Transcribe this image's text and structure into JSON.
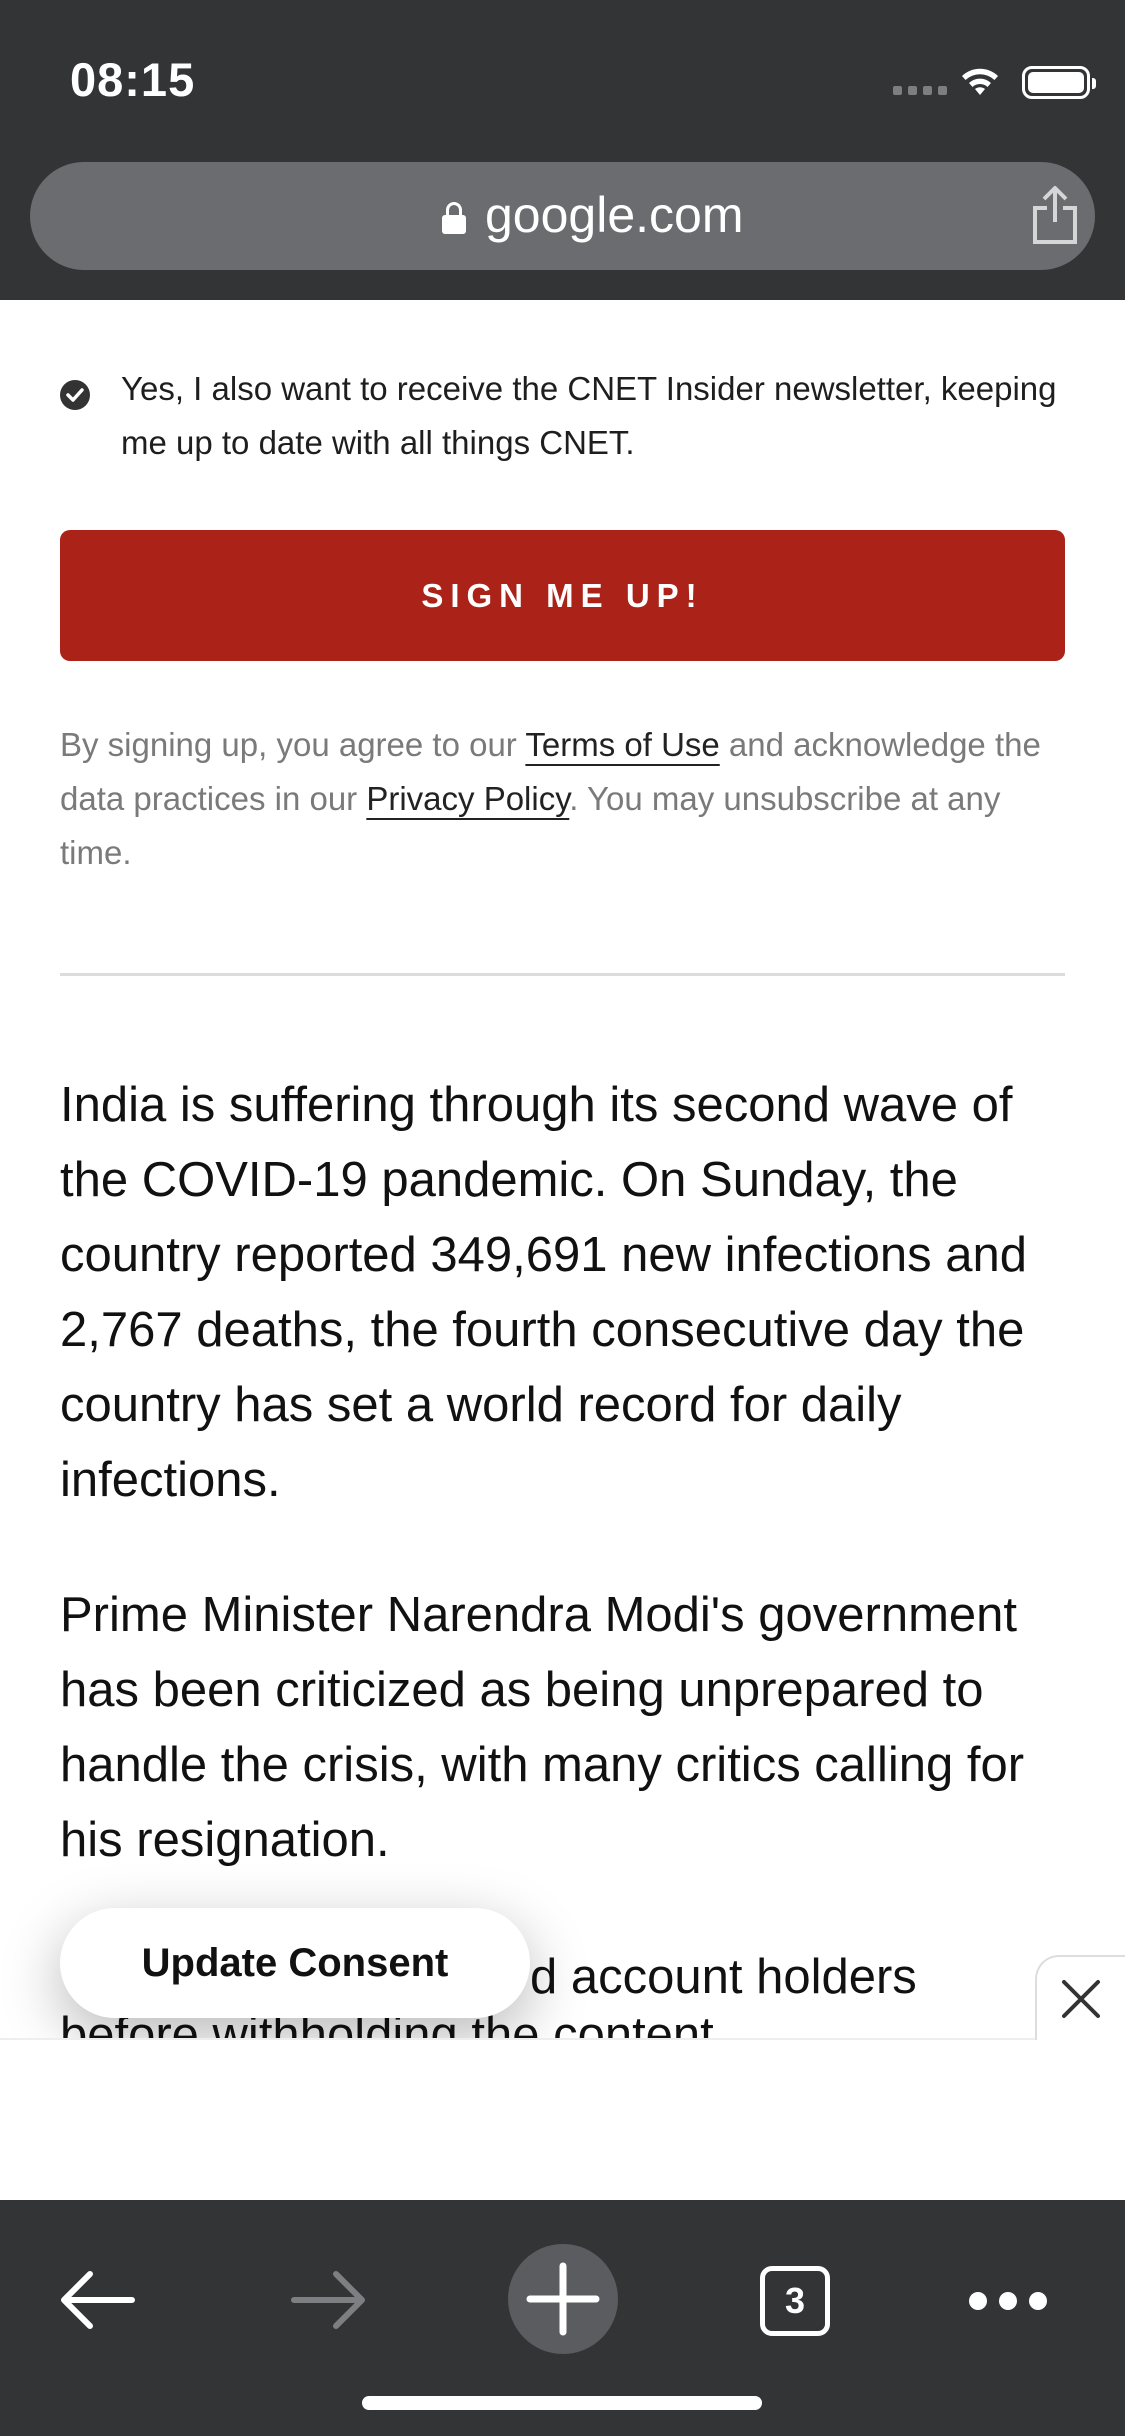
{
  "status_bar": {
    "time": "08:15"
  },
  "address_bar": {
    "domain": "google.com"
  },
  "newsletter": {
    "checkbox_label": "Yes, I also want to receive the CNET Insider newsletter, keeping me up to date with all things CNET.",
    "signup_button": "SIGN ME UP!",
    "legal_prefix": "By signing up, you agree to our ",
    "terms_link": "Terms of Use",
    "legal_middle": " and acknowledge the data practices in our ",
    "privacy_link": "Privacy Policy",
    "legal_suffix": ". You may unsubscribe at any time."
  },
  "article": {
    "paragraphs": [
      "India is suffering through its second wave of the COVID-19 pandemic. On Sunday, the country reported 349,691 new infections and 2,767 deaths, the fourth consecutive day the country has set a world record for daily infections.",
      "Prime Minister Narendra Modi's government has been criticized as being unprepared to handle the crisis, with many critics calling for his resignation."
    ],
    "partial_line": "d account holders",
    "partial_line_2": "before withholding the content"
  },
  "consent": {
    "button_label": "Update Consent"
  },
  "toolbar": {
    "tab_count": "3"
  }
}
